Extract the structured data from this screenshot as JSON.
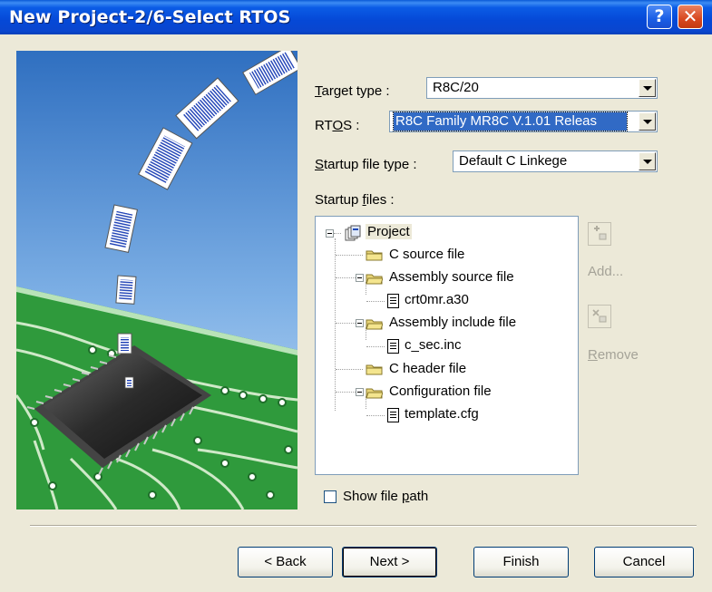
{
  "window": {
    "title": "New Project-2/6-Select RTOS",
    "help_label": "?",
    "close_label": "✕"
  },
  "form": {
    "target_type": {
      "label_prefix": "",
      "label_underline": "T",
      "label_rest": "arget type :",
      "value": "R8C/20"
    },
    "rtos": {
      "label_prefix": "RT",
      "label_underline": "O",
      "label_rest": "S :",
      "value": "R8C Family MR8C V.1.01 Releas"
    },
    "startup_file_type": {
      "label_prefix": "",
      "label_underline": "S",
      "label_rest": "tartup file type :",
      "value": "Default C Linkege"
    },
    "startup_files": {
      "label_prefix": "Startup ",
      "label_underline": "f",
      "label_rest": "iles :"
    }
  },
  "tree": {
    "root": "Project",
    "c_source": "C source file",
    "asm_source": "Assembly source file",
    "asm_source_file": "crt0mr.a30",
    "asm_include": "Assembly include file",
    "asm_include_file": "c_sec.inc",
    "c_header": "C header file",
    "config": "Configuration file",
    "config_file": "template.cfg"
  },
  "side_buttons": {
    "add_label": "Add...",
    "remove_label": "Remove"
  },
  "show_path": {
    "label_prefix": "Show file ",
    "label_underline": "p",
    "label_rest": "ath"
  },
  "buttons": {
    "back": "< Back",
    "next": "Next >",
    "finish": "Finish",
    "cancel": "Cancel"
  },
  "colors": {
    "title_bar": "#0a56d8",
    "dialog_bg": "#ece9d8",
    "pcb_green": "#2f9a3c",
    "selection": "#316ac5"
  }
}
